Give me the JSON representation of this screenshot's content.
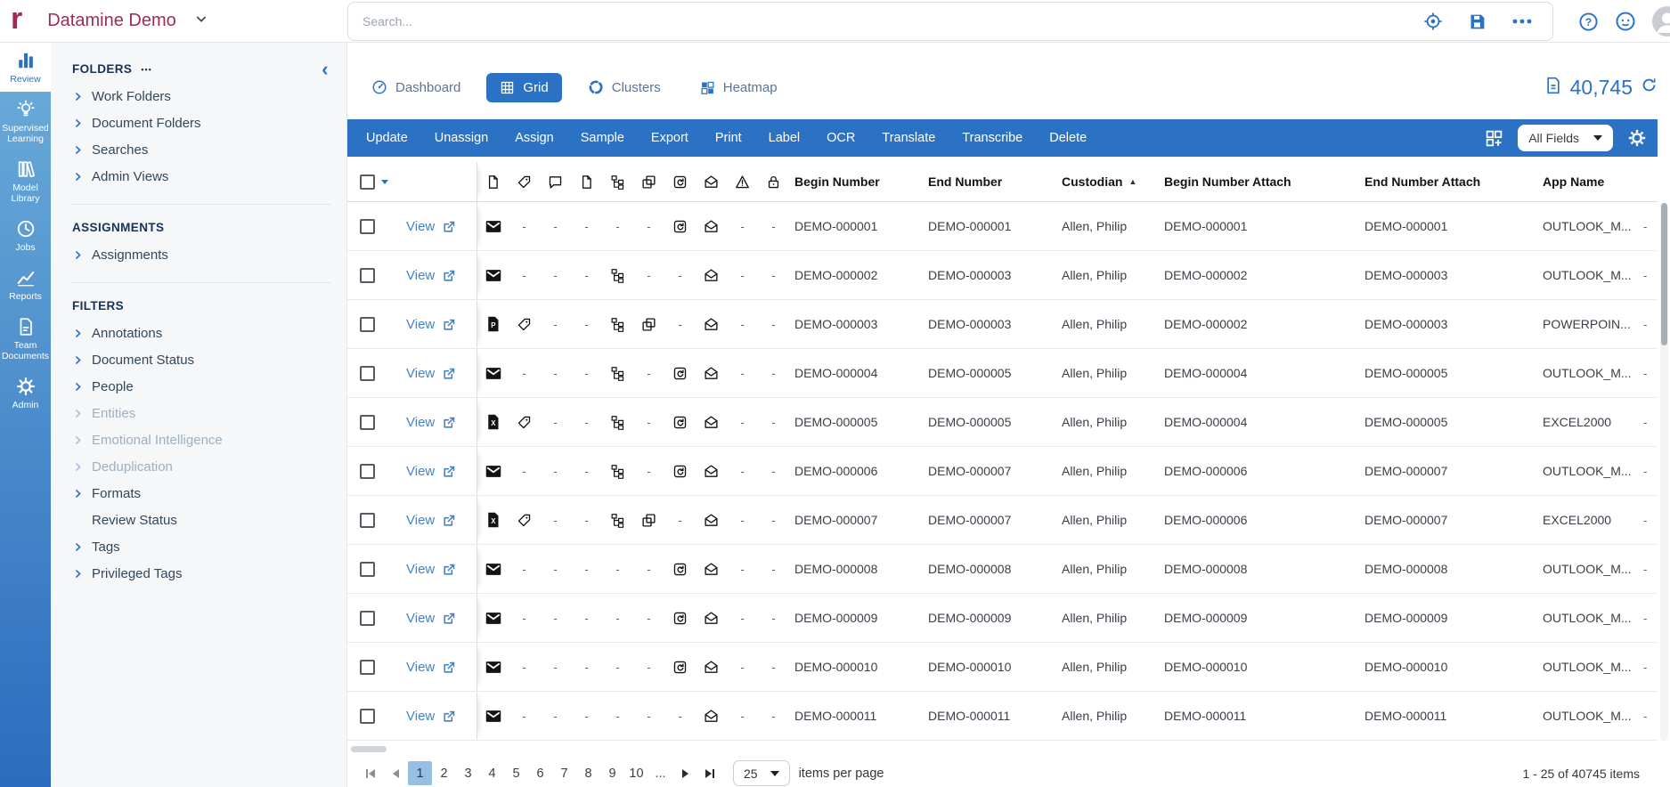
{
  "colors": {
    "blue": "#2c72c4",
    "blue_link": "#3f83cc",
    "maroon": "#9e2c52",
    "rail_top": "#6cadda",
    "rail_bottom": "#2b6cbe",
    "panel_bg": "#f5f7f9",
    "page_selected": "#96bfe3"
  },
  "app": {
    "logo_letter": "r",
    "workspace": "Datamine Demo"
  },
  "topbar": {
    "search_placeholder": "Search...",
    "icons": [
      "target-icon",
      "save-icon",
      "more-icon",
      "help-icon",
      "support-icon",
      "avatar"
    ]
  },
  "rail": {
    "items": [
      {
        "label": "Review",
        "icon": "bar-chart",
        "active": true
      },
      {
        "label": "Supervised Learning",
        "icon": "bulb",
        "active": false
      },
      {
        "label": "Model Library",
        "icon": "books",
        "active": false
      },
      {
        "label": "Jobs",
        "icon": "clock",
        "active": false
      },
      {
        "label": "Reports",
        "icon": "line-chart",
        "active": false
      },
      {
        "label": "Team Documents",
        "icon": "doc",
        "active": false
      },
      {
        "label": "Admin",
        "icon": "gear",
        "active": false
      }
    ]
  },
  "sidebar": {
    "sections": [
      {
        "title": "FOLDERS",
        "menu_dots": true,
        "collapse": true,
        "items": [
          {
            "label": "Work Folders"
          },
          {
            "label": "Document Folders"
          },
          {
            "label": "Searches"
          },
          {
            "label": "Admin Views"
          }
        ]
      },
      {
        "title": "ASSIGNMENTS",
        "items": [
          {
            "label": "Assignments"
          }
        ]
      },
      {
        "title": "FILTERS",
        "items": [
          {
            "label": "Annotations"
          },
          {
            "label": "Document Status"
          },
          {
            "label": "People"
          },
          {
            "label": "Entities",
            "disabled": true
          },
          {
            "label": "Emotional Intelligence",
            "disabled": true
          },
          {
            "label": "Deduplication",
            "disabled": true
          },
          {
            "label": "Formats"
          },
          {
            "label": "Review Status",
            "no_chevron": true
          },
          {
            "label": "Tags"
          },
          {
            "label": "Privileged Tags"
          }
        ]
      }
    ]
  },
  "tabs": [
    {
      "label": "Dashboard",
      "icon": "gauge",
      "active": false
    },
    {
      "label": "Grid",
      "icon": "grid",
      "active": true
    },
    {
      "label": "Clusters",
      "icon": "clusters",
      "active": false
    },
    {
      "label": "Heatmap",
      "icon": "heatmap",
      "active": false
    }
  ],
  "doc_count": {
    "value": "40,745",
    "icon": "doc-icon",
    "refresh": "refresh-icon"
  },
  "toolbar": {
    "buttons": [
      "Update",
      "Unassign",
      "Assign",
      "Sample",
      "Export",
      "Print",
      "Label",
      "OCR",
      "Translate",
      "Transcribe",
      "Delete"
    ],
    "fields_dropdown": "All Fields",
    "right_icons": [
      "layout-grid-plus-icon",
      "gear-icon"
    ]
  },
  "table": {
    "view_label": "View",
    "icon_columns": [
      "file",
      "tag",
      "comment",
      "page",
      "tree",
      "copy",
      "loop",
      "mail-open",
      "warning",
      "lock"
    ],
    "text_columns": [
      {
        "label": "Begin Number"
      },
      {
        "label": "End Number"
      },
      {
        "label": "Custodian",
        "sorted": "asc"
      },
      {
        "label": "Begin Number Attach"
      },
      {
        "label": "End Number Attach"
      },
      {
        "label": "App Name"
      }
    ],
    "rows": [
      {
        "icons": [
          "envelope",
          "-",
          "-",
          "-",
          "-",
          "-",
          "loop",
          "mail-open",
          "-",
          "-"
        ],
        "begin": "DEMO-000001",
        "end": "DEMO-000001",
        "custodian": "Allen, Philip",
        "begin_attach": "DEMO-000001",
        "end_attach": "DEMO-000001",
        "app": "OUTLOOK_M...",
        "trail": "-"
      },
      {
        "icons": [
          "envelope",
          "-",
          "-",
          "-",
          "tree",
          "-",
          "-",
          "mail-open",
          "-",
          "-"
        ],
        "begin": "DEMO-000002",
        "end": "DEMO-000003",
        "custodian": "Allen, Philip",
        "begin_attach": "DEMO-000002",
        "end_attach": "DEMO-000003",
        "app": "OUTLOOK_M...",
        "trail": "-"
      },
      {
        "icons": [
          "file-p",
          "tag",
          "-",
          "-",
          "tree",
          "copy",
          "-",
          "mail-open",
          "-",
          "-"
        ],
        "begin": "DEMO-000003",
        "end": "DEMO-000003",
        "custodian": "Allen, Philip",
        "begin_attach": "DEMO-000002",
        "end_attach": "DEMO-000003",
        "app": "POWERPOIN...",
        "trail": "-"
      },
      {
        "icons": [
          "envelope",
          "-",
          "-",
          "-",
          "tree",
          "-",
          "loop",
          "mail-open",
          "-",
          "-"
        ],
        "begin": "DEMO-000004",
        "end": "DEMO-000005",
        "custodian": "Allen, Philip",
        "begin_attach": "DEMO-000004",
        "end_attach": "DEMO-000005",
        "app": "OUTLOOK_M...",
        "trail": "-"
      },
      {
        "icons": [
          "file-x",
          "tag",
          "-",
          "-",
          "tree",
          "-",
          "loop",
          "mail-open",
          "-",
          "-"
        ],
        "begin": "DEMO-000005",
        "end": "DEMO-000005",
        "custodian": "Allen, Philip",
        "begin_attach": "DEMO-000004",
        "end_attach": "DEMO-000005",
        "app": "EXCEL2000",
        "trail": "-"
      },
      {
        "icons": [
          "envelope",
          "-",
          "-",
          "-",
          "tree",
          "-",
          "loop",
          "mail-open",
          "-",
          "-"
        ],
        "begin": "DEMO-000006",
        "end": "DEMO-000007",
        "custodian": "Allen, Philip",
        "begin_attach": "DEMO-000006",
        "end_attach": "DEMO-000007",
        "app": "OUTLOOK_M...",
        "trail": "-"
      },
      {
        "icons": [
          "file-x",
          "tag",
          "-",
          "-",
          "tree",
          "copy",
          "-",
          "mail-open",
          "-",
          "-"
        ],
        "begin": "DEMO-000007",
        "end": "DEMO-000007",
        "custodian": "Allen, Philip",
        "begin_attach": "DEMO-000006",
        "end_attach": "DEMO-000007",
        "app": "EXCEL2000",
        "trail": "-"
      },
      {
        "icons": [
          "envelope",
          "-",
          "-",
          "-",
          "-",
          "-",
          "loop",
          "mail-open",
          "-",
          "-"
        ],
        "begin": "DEMO-000008",
        "end": "DEMO-000008",
        "custodian": "Allen, Philip",
        "begin_attach": "DEMO-000008",
        "end_attach": "DEMO-000008",
        "app": "OUTLOOK_M...",
        "trail": "-"
      },
      {
        "icons": [
          "envelope",
          "-",
          "-",
          "-",
          "-",
          "-",
          "loop",
          "mail-open",
          "-",
          "-"
        ],
        "begin": "DEMO-000009",
        "end": "DEMO-000009",
        "custodian": "Allen, Philip",
        "begin_attach": "DEMO-000009",
        "end_attach": "DEMO-000009",
        "app": "OUTLOOK_M...",
        "trail": "-"
      },
      {
        "icons": [
          "envelope",
          "-",
          "-",
          "-",
          "-",
          "-",
          "loop",
          "mail-open",
          "-",
          "-"
        ],
        "begin": "DEMO-000010",
        "end": "DEMO-000010",
        "custodian": "Allen, Philip",
        "begin_attach": "DEMO-000010",
        "end_attach": "DEMO-000010",
        "app": "OUTLOOK_M...",
        "trail": "-"
      },
      {
        "icons": [
          "envelope",
          "-",
          "-",
          "-",
          "-",
          "-",
          "-",
          "mail-open",
          "-",
          "-"
        ],
        "begin": "DEMO-000011",
        "end": "DEMO-000011",
        "custodian": "Allen, Philip",
        "begin_attach": "DEMO-000011",
        "end_attach": "DEMO-000011",
        "app": "OUTLOOK_M...",
        "trail": "-"
      }
    ]
  },
  "pagination": {
    "pages": [
      "1",
      "2",
      "3",
      "4",
      "5",
      "6",
      "7",
      "8",
      "9",
      "10"
    ],
    "current": "1",
    "ellipsis": "...",
    "page_size": "25",
    "items_per_page_label": "items per page",
    "range_label": "1 - 25 of 40745 items"
  }
}
